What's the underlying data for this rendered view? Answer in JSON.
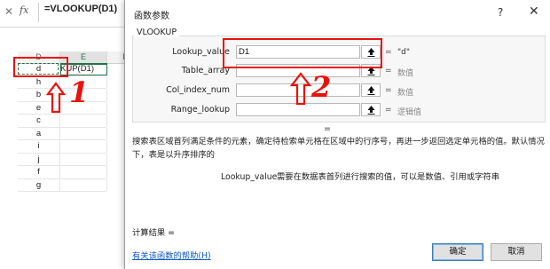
{
  "formula_bar": {
    "cancel_symbol": "✕",
    "fx_label": "fx",
    "formula": "=VLOOKUP(D1)"
  },
  "sheet": {
    "col_d": "D",
    "col_e": "E",
    "col_f": "F",
    "column_d_values": [
      "d",
      "h",
      "b",
      "e",
      "c",
      "a",
      "i",
      "j",
      "f",
      "g"
    ],
    "active_cell_text": "KUP(D1)"
  },
  "annotations": {
    "num1": "1",
    "num2": "2",
    "color": "#e8120c"
  },
  "dialog": {
    "title": "函数参数",
    "help_symbol": "?",
    "close_symbol": "✕",
    "function_name": "VLOOKUP",
    "args": [
      {
        "label": "Lookup_value",
        "value": "D1",
        "result": "\"d\""
      },
      {
        "label": "Table_array",
        "value": "",
        "result": "数值"
      },
      {
        "label": "Col_index_num",
        "value": "",
        "result": "数值"
      },
      {
        "label": "Range_lookup",
        "value": "",
        "result": "逻辑值"
      }
    ],
    "eq_symbol": "=",
    "result_eq": "=",
    "description": "搜索表区域首列满足条件的元素，确定待检索单元格在区域中的行序号，再进一步返回选定单元格的值。默认情况下，表是以升序排序的",
    "arg_help_name": "Lookup_value",
    "arg_help_text": "需要在数据表首列进行搜索的值，可以是数值、引用或字符串",
    "calc_result_label": "计算结果 =",
    "help_link": "有关该函数的帮助(H)",
    "ok_label": "确定",
    "cancel_label": "取消"
  }
}
